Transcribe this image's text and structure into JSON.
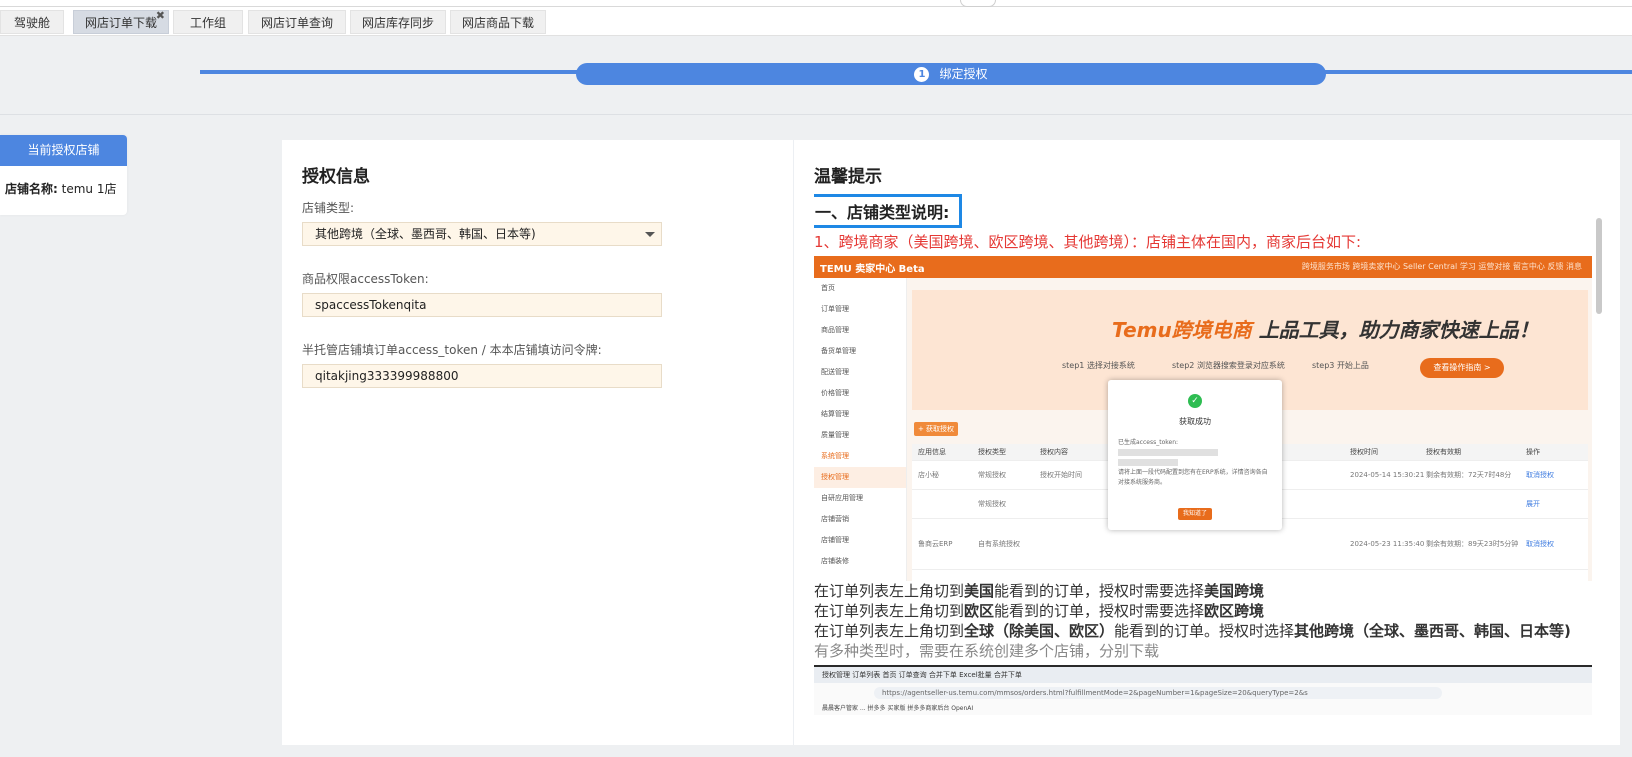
{
  "tabs": [
    {
      "label": "驾驶舱",
      "active": false,
      "closable": false
    },
    {
      "label": "网店订单下载",
      "active": true,
      "closable": true
    },
    {
      "label": "工作组",
      "active": false,
      "closable": false
    },
    {
      "label": "网店订单查询",
      "active": false,
      "closable": false
    },
    {
      "label": "网店库存同步",
      "active": false,
      "closable": false
    },
    {
      "label": "网店商品下载",
      "active": false,
      "closable": false
    }
  ],
  "tab_close_glyph": "✖",
  "step": {
    "number": "1",
    "label": "绑定授权"
  },
  "store_card": {
    "header": "当前授权店铺",
    "name_label": "店铺名称:",
    "name_value": "temu 1店"
  },
  "auth_info": {
    "title": "授权信息",
    "fields": [
      {
        "label": "店铺类型:",
        "value": "其他跨境（全球、墨西哥、韩国、日本等)",
        "type": "select"
      },
      {
        "label": "商品权限accessToken:",
        "value": "spaccessTokenqita",
        "type": "text"
      },
      {
        "label": "半托管店铺填订单access_token / 本本店铺填访问令牌:",
        "value": "qitakjing333399988800",
        "type": "text"
      }
    ]
  },
  "tips": {
    "title": "温馨提示",
    "section_heading": "一、店铺类型说明:",
    "red_line": "1、跨境商家（美国跨境、欧区跨境、其他跨境）：店铺主体在国内，商家后台如下:",
    "lines": [
      {
        "p1": "在订单列表左上角切到",
        "b1": "美国",
        "p2": "能看到的订单，授权时需要选择",
        "b2": "美国跨境"
      },
      {
        "p1": "在订单列表左上角切到",
        "b1": "欧区",
        "p2": "能看到的订单，授权时需要选择",
        "b2": "欧区跨境"
      },
      {
        "p1": "在订单列表左上角切到",
        "b1": "全球（除美国、欧区）",
        "p2": "能看到的订单。授权时选择",
        "b2": "其他跨境（全球、墨西哥、韩国、日本等)"
      }
    ],
    "gray_line": "有多种类型时，需要在系统创建多个店铺，分别下载"
  },
  "screenshot": {
    "logo": "TEMU 卖家中心 Beta",
    "header_links": "跨境服务市场   跨境卖家中心   Seller Central   学习   运营对接   留言中心   反馈   消息",
    "sidebar": [
      "首页",
      "订单管理",
      "商品管理",
      "备货单管理",
      "配送管理",
      "价格管理",
      "结算管理",
      "质量管理",
      "系统管理",
      "授权管理",
      "自研应用管理",
      "店铺营销",
      "店铺管理",
      "店铺装修"
    ],
    "banner_title_orange": "Temu跨境电商",
    "banner_title_dark": "上品工具，助力商家快速上品！",
    "banner_steps": [
      "step1 选择对接系统",
      "step2 浏览器搜索登录对应系统",
      "step3 开始上品"
    ],
    "banner_button": "查看操作指南 >",
    "add_auth_button": "+ 获取授权",
    "table_header": [
      "应用信息",
      "授权类型",
      "授权内容",
      "授权时间",
      "授权有效期",
      "操作"
    ],
    "table_rows": [
      [
        "店小秘",
        "常规授权",
        "授权开始时间",
        "2024-05-14 15:30:21",
        "剩余有效期：72天7时48分",
        "取消授权"
      ],
      [
        "",
        "常规授权",
        "",
        "",
        "",
        "展开"
      ],
      [
        "鲁商云ERP",
        "自有系统授权",
        "",
        "2024-05-23 11:35:40",
        "剩余有效期：89天23时5分钟",
        "取消授权"
      ]
    ],
    "modal_title": "获取成功",
    "modal_text1": "已生成access_token:",
    "modal_text2": "请将上面一段代码配置到您有在ERP系统，详情咨询各自对接系统服务商。",
    "modal_button": "我知道了"
  },
  "browser_shot": {
    "tabs": "授权管理   订单列表   首页   订单查询   合并下单   Excel批量   合并下单",
    "url": "https://agentseller-us.temu.com/mmsos/orders.html?fulfillmentMode=2&pageNumber=1&pageSize=20&queryType=2&s",
    "bookmarks": "晨晨客户管家   ...   拼多多 买家版   拼多多商家后台   OpenAI"
  }
}
